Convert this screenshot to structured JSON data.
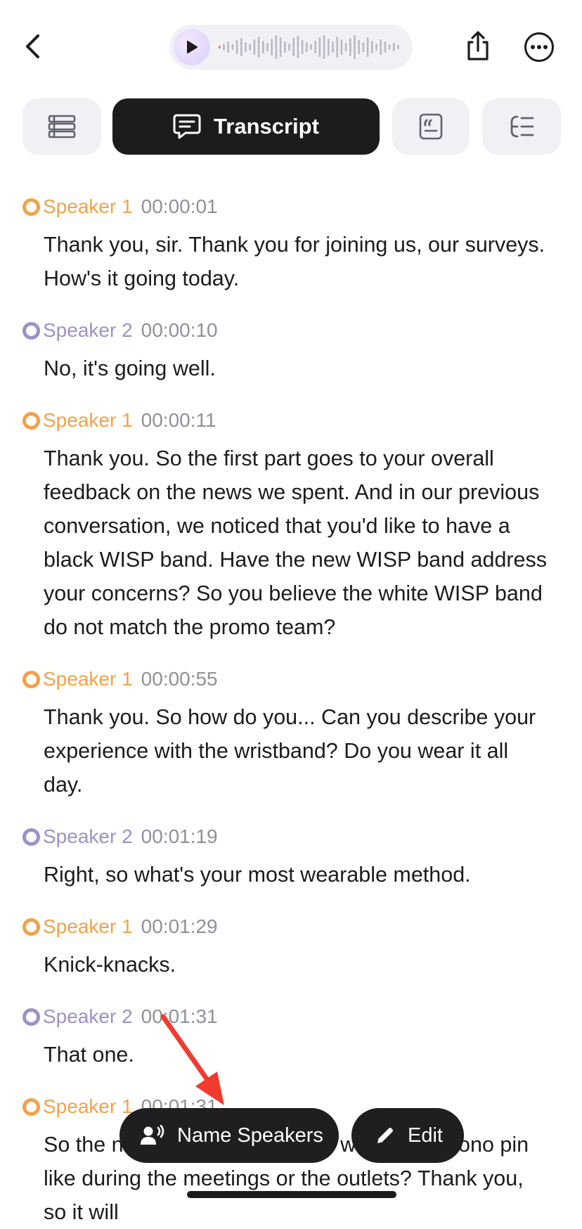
{
  "header": {
    "icons": {
      "back": "chevron-left-icon",
      "play": "play-icon",
      "share": "share-icon",
      "more": "more-icon"
    }
  },
  "tabs": [
    {
      "id": "overview",
      "icon": "list-icon",
      "label": ""
    },
    {
      "id": "transcript",
      "icon": "chat-bubble-icon",
      "label": "Transcript",
      "active": true
    },
    {
      "id": "quotes",
      "icon": "quote-icon",
      "label": ""
    },
    {
      "id": "outline",
      "icon": "outline-icon",
      "label": ""
    }
  ],
  "colors": {
    "speaker1": "#f2a24a",
    "speaker2": "#9b92c7",
    "active_tab": "#1c1c1e"
  },
  "transcript": [
    {
      "speaker": "Speaker 1",
      "time": "00:00:01",
      "text": "Thank you, sir. Thank you for joining us, our surveys. How's it going today."
    },
    {
      "speaker": "Speaker 2",
      "time": "00:00:10",
      "text": "No, it's going well."
    },
    {
      "speaker": "Speaker 1",
      "time": "00:00:11",
      "text": "Thank you. So the first part goes to your overall feedback on the news we spent. And in our previous conversation, we noticed that you'd like to have a black WISP band. Have the new WISP band address your concerns? So you believe the white WISP band do not match the promo team?"
    },
    {
      "speaker": "Speaker 1",
      "time": "00:00:55",
      "text": "Thank you. So how do you... Can you describe your experience with the wristband? Do you wear it all day."
    },
    {
      "speaker": "Speaker 2",
      "time": "00:01:19",
      "text": "Right, so what's your most wearable method."
    },
    {
      "speaker": "Speaker 1",
      "time": "00:01:29",
      "text": "Knick-knacks."
    },
    {
      "speaker": "Speaker 2",
      "time": "00:01:31",
      "text": "That one."
    },
    {
      "speaker": "Speaker 1",
      "time": "00:01:31",
      "text": "So the n d band, right? Do you wear the chrono pin like during the meetings or the outlets? Thank you, so it will"
    }
  ],
  "actions": {
    "name_speakers": "Name Speakers",
    "edit": "Edit"
  }
}
